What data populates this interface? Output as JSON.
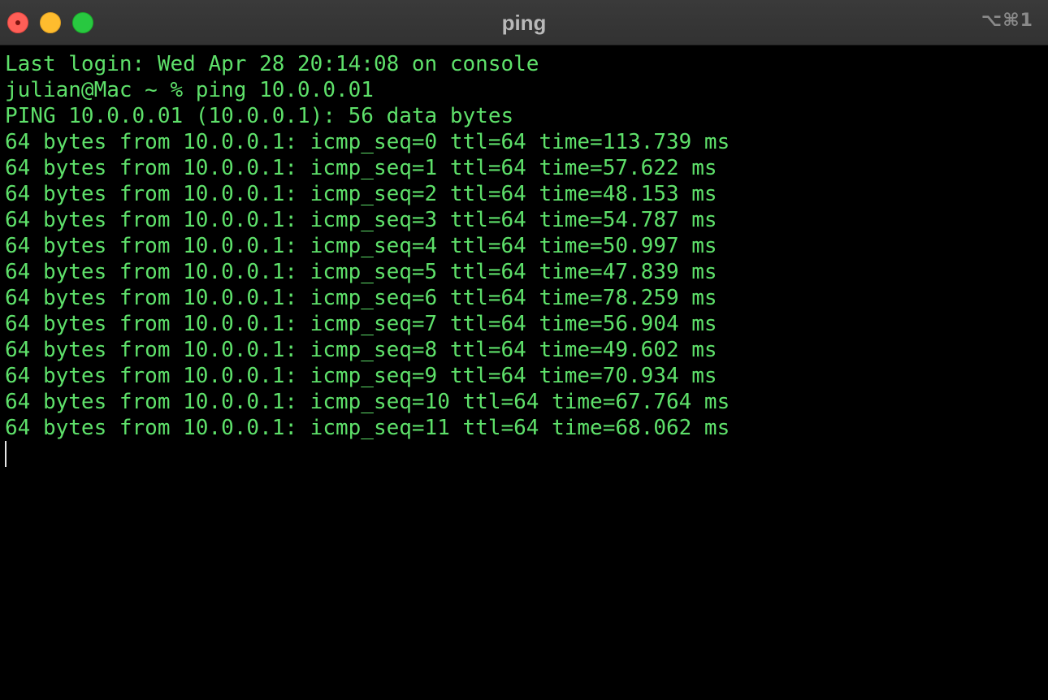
{
  "window": {
    "title": "ping",
    "shortcut": "⌥⌘1",
    "colors": {
      "background": "#000000",
      "text": "#5ee06a",
      "titlebar": "#363636",
      "close": "#ff5f57",
      "minimize": "#febc2e",
      "zoom": "#28c840"
    }
  },
  "terminal": {
    "lines": [
      "Last login: Wed Apr 28 20:14:08 on console",
      "julian@Mac ~ % ping 10.0.0.01",
      "PING 10.0.0.01 (10.0.0.1): 56 data bytes",
      "64 bytes from 10.0.0.1: icmp_seq=0 ttl=64 time=113.739 ms",
      "64 bytes from 10.0.0.1: icmp_seq=1 ttl=64 time=57.622 ms",
      "64 bytes from 10.0.0.1: icmp_seq=2 ttl=64 time=48.153 ms",
      "64 bytes from 10.0.0.1: icmp_seq=3 ttl=64 time=54.787 ms",
      "64 bytes from 10.0.0.1: icmp_seq=4 ttl=64 time=50.997 ms",
      "64 bytes from 10.0.0.1: icmp_seq=5 ttl=64 time=47.839 ms",
      "64 bytes from 10.0.0.1: icmp_seq=6 ttl=64 time=78.259 ms",
      "64 bytes from 10.0.0.1: icmp_seq=7 ttl=64 time=56.904 ms",
      "64 bytes from 10.0.0.1: icmp_seq=8 ttl=64 time=49.602 ms",
      "64 bytes from 10.0.0.1: icmp_seq=9 ttl=64 time=70.934 ms",
      "64 bytes from 10.0.0.1: icmp_seq=10 ttl=64 time=67.764 ms",
      "64 bytes from 10.0.0.1: icmp_seq=11 ttl=64 time=68.062 ms"
    ]
  }
}
